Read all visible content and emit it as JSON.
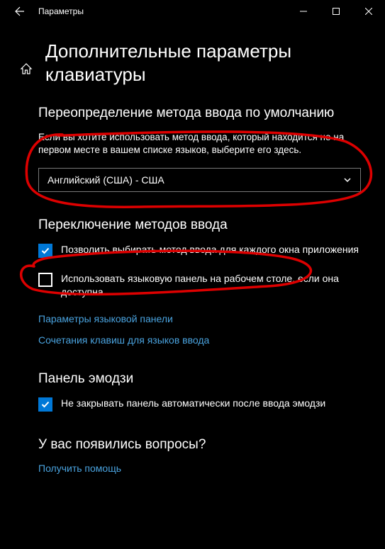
{
  "titlebar": {
    "title": "Параметры"
  },
  "page": {
    "title": "Дополнительные параметры клавиатуры"
  },
  "section_override": {
    "heading": "Переопределение метода ввода по умолчанию",
    "desc": "Если вы хотите использовать метод ввода, который находится не на первом месте в вашем списке языков, выберите его здесь.",
    "dropdown_value": "Английский (США) - США"
  },
  "section_switching": {
    "heading": "Переключение методов ввода",
    "checkbox1_label": "Позволить выбирать метод ввода для каждого окна приложения",
    "checkbox2_label": "Использовать языковую панель на рабочем столе, если она доступна",
    "link1": "Параметры языковой панели",
    "link2": "Сочетания клавиш для языков ввода"
  },
  "section_emoji": {
    "heading": "Панель эмодзи",
    "checkbox_label": "Не закрывать панель автоматически после ввода эмодзи"
  },
  "section_help": {
    "heading": "У вас появились вопросы?",
    "link": "Получить помощь"
  }
}
